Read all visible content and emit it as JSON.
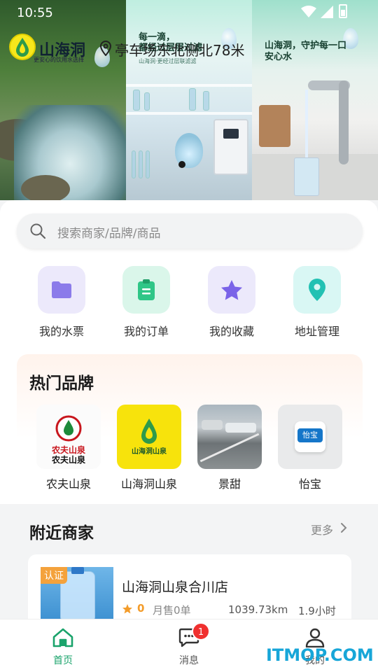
{
  "status_bar": {
    "time": "10:55"
  },
  "header": {
    "brand_title": "山海洞",
    "brand_subtitle": "更安心的饮用水选择",
    "location": "亭车场东北侧北78米"
  },
  "banner": {
    "slogan_1": "每一滴，",
    "slogan_1b": "都经过层层过滤",
    "slogan_1_sub": "山海洞·更经过层联滤滤",
    "slogan_2": "山海洞，守护每一口安心水"
  },
  "search": {
    "placeholder": "搜索商家/品牌/商品"
  },
  "quick_actions": [
    {
      "label": "我的水票",
      "icon": "folder-icon",
      "bg": "#ece9fb",
      "color": "#8b7bea"
    },
    {
      "label": "我的订单",
      "icon": "clipboard-icon",
      "bg": "#daf6ea",
      "color": "#2fc687"
    },
    {
      "label": "我的收藏",
      "icon": "star-icon",
      "bg": "#ece9fb",
      "color": "#7a63e8"
    },
    {
      "label": "地址管理",
      "icon": "map-pin-icon",
      "bg": "#d9f7f4",
      "color": "#22c1b3"
    }
  ],
  "hot_brands": {
    "title": "热门品牌",
    "items": [
      {
        "name": "农夫山泉",
        "logo_text": "农夫山泉"
      },
      {
        "name": "山海洞山泉",
        "logo_text": "山海洞山泉"
      },
      {
        "name": "景甜"
      },
      {
        "name": "怡宝",
        "logo_text": "怡宝"
      }
    ]
  },
  "nearby": {
    "title": "附近商家",
    "more": "更多",
    "shops": [
      {
        "badge": "认证",
        "name": "山海洞山泉合川店",
        "rating": "0",
        "sold": "月售0单",
        "distance": "1039.73km",
        "eta": "1.9小时"
      }
    ]
  },
  "tabbar": {
    "items": [
      {
        "label": "首页",
        "active": true
      },
      {
        "label": "消息",
        "badge": "1"
      },
      {
        "label": "我的"
      }
    ]
  },
  "watermark": "ITMOP.COM",
  "colors": {
    "accent": "#1aa36b",
    "badge": "#f0302f",
    "rating": "#f39c2a"
  }
}
